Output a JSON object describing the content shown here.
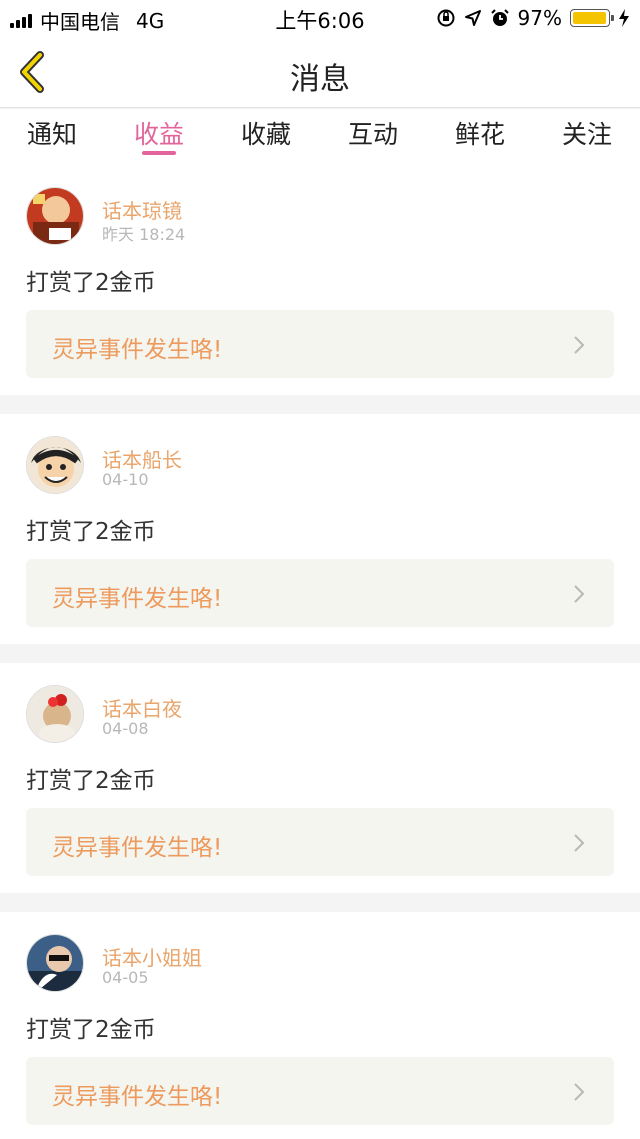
{
  "status_bar": {
    "carrier": "中国电信",
    "network": "4G",
    "time": "上午6:06",
    "battery": "97%",
    "battery_level": 0.97,
    "icons": [
      "lock-rotation-icon",
      "location-icon",
      "alarm-icon",
      "charging-icon"
    ]
  },
  "header": {
    "title": "消息",
    "back_icon": "back-chevron-icon"
  },
  "tabs": [
    {
      "label": "通知",
      "active": false
    },
    {
      "label": "收益",
      "active": true
    },
    {
      "label": "收藏",
      "active": false
    },
    {
      "label": "互动",
      "active": false
    },
    {
      "label": "鲜花",
      "active": false
    },
    {
      "label": "关注",
      "active": false
    }
  ],
  "colors": {
    "accent": "#e3649b",
    "username": "#e9a56b",
    "link_text": "#ec9a5d",
    "battery": "#f5c400"
  },
  "messages": [
    {
      "username": "话本琼镜",
      "date": "昨天 18:24",
      "text": "打赏了2金币",
      "story": "灵异事件发生咯!"
    },
    {
      "username": "话本船长",
      "date": "04-10",
      "text": "打赏了2金币",
      "story": "灵异事件发生咯!"
    },
    {
      "username": "话本白夜",
      "date": "04-08",
      "text": "打赏了2金币",
      "story": "灵异事件发生咯!"
    },
    {
      "username": "话本小姐姐",
      "date": "04-05",
      "text": "打赏了2金币",
      "story": "灵异事件发生咯!"
    }
  ]
}
